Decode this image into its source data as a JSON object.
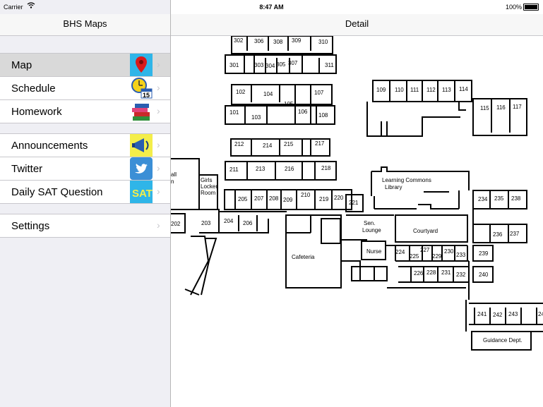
{
  "status_bar": {
    "carrier": "Carrier",
    "time": "8:47 AM",
    "battery": "100%"
  },
  "master": {
    "title": "BHS Maps",
    "groups": [
      [
        {
          "label": "Map",
          "icon": "map-pin-icon",
          "selected": true
        },
        {
          "label": "Schedule",
          "icon": "clock-calendar-icon",
          "icon_text": "15"
        },
        {
          "label": "Homework",
          "icon": "books-icon"
        }
      ],
      [
        {
          "label": "Announcements",
          "icon": "megaphone-icon"
        },
        {
          "label": "Twitter",
          "icon": "twitter-bird-icon"
        },
        {
          "label": "Daily SAT Question",
          "icon": "sat-icon",
          "icon_text": "SAT"
        }
      ],
      [
        {
          "label": "Settings"
        }
      ]
    ]
  },
  "detail": {
    "title": "Detail",
    "map_labels": {
      "r302": "302",
      "r306": "306",
      "r308": "308",
      "r309": "309",
      "r310": "310",
      "r301": "301",
      "r303": "303",
      "r304": "304",
      "r305": "305",
      "r307": "307",
      "r311": "311",
      "r102": "102",
      "r104": "104",
      "r107": "107",
      "r105": "105",
      "r101": "101",
      "r103": "103",
      "r106": "106",
      "r108": "108",
      "r212": "212",
      "r214": "214",
      "r215": "215",
      "r217": "217",
      "r211": "211",
      "r213": "213",
      "r216": "216",
      "r218": "218",
      "r205": "205",
      "r207": "207",
      "r208": "208",
      "r209": "209",
      "r210": "210",
      "r219": "219",
      "r220": "220",
      "r221": "221",
      "r202": "202",
      "r203": "203",
      "r204": "204",
      "r206": "206",
      "r109": "109",
      "r110": "110",
      "r111": "111",
      "r112": "112",
      "r113": "113",
      "r114": "114",
      "r115": "115",
      "r116": "116",
      "r117": "117",
      "r234": "234",
      "r235": "235",
      "r238": "238",
      "r236": "236",
      "r237": "237",
      "r239": "239",
      "r240": "240",
      "r224": "224",
      "r225": "225",
      "r227": "227",
      "r229": "229",
      "r230": "230",
      "r233": "233",
      "r226": "226",
      "r228": "228",
      "r231": "231",
      "r232": "232",
      "r241": "241",
      "r242": "242",
      "r243": "243",
      "r24x": "24",
      "hall1": "all",
      "hall2": "n",
      "girls1": "Girls",
      "girls2": "Locker",
      "girls3": "Room",
      "lc1": "Learning Commons",
      "lc2": "Library",
      "sen1": "Sen.",
      "sen2": "Lounge",
      "courtyard": "Courtyard",
      "cafeteria": "Cafeteria",
      "nurse": "Nurse",
      "guidance": "Guidance Dept."
    }
  }
}
